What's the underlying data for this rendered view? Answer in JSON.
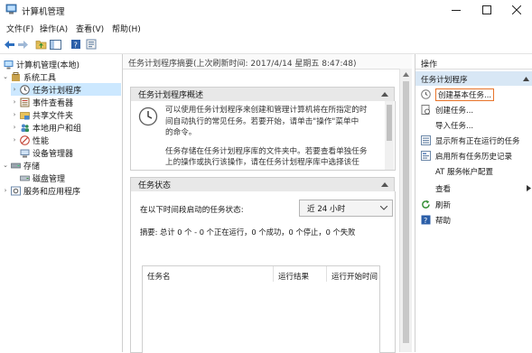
{
  "window": {
    "title": "计算机管理"
  },
  "menu": {
    "items": [
      "文件(F)",
      "操作(A)",
      "查看(V)",
      "帮助(H)"
    ]
  },
  "tree": {
    "root": "计算机管理(本地)",
    "system_tools": "系统工具",
    "task_scheduler": "任务计划程序",
    "event_viewer": "事件查看器",
    "shared_folders": "共享文件夹",
    "local_users": "本地用户和组",
    "performance": "性能",
    "device_manager": "设备管理器",
    "storage": "存储",
    "disk_management": "磁盘管理",
    "services_apps": "服务和应用程序"
  },
  "main": {
    "header": "任务计划程序摘要(上次刷新时间: 2017/4/14 星期五 8:47:48)",
    "overview": {
      "title": "任务计划程序概述",
      "para1": [
        "可以使用任务计划程序来创建和管理计算机将在所指定的时",
        "间自动执行的常见任务。若要开始，请单击\"操作\"菜单中",
        "的命令。"
      ],
      "para2": [
        "任务存储在任务计划程序库的文件夹中。若要查看单独任务",
        "上的操作或执行该操作，请在任务计划程序库中选择该任"
      ]
    },
    "status": {
      "title": "任务状态",
      "label": "在以下时间段启动的任务状态:",
      "period": "近 24 小时",
      "summary": "摘要: 总计 0 个 - 0 个正在运行，0 个成功，0 个停止，0 个失败",
      "columns": [
        "任务名",
        "运行结果",
        "运行开始时间"
      ]
    }
  },
  "actions": {
    "header": "操作",
    "section": "任务计划程序",
    "items": [
      {
        "label": "创建基本任务...",
        "icon": "wizard-icon"
      },
      {
        "label": "创建任务...",
        "icon": "task-icon"
      },
      {
        "label": "导入任务...",
        "icon": ""
      },
      {
        "label": "显示所有正在运行的任务",
        "icon": "list-icon"
      },
      {
        "label": "启用所有任务历史记录",
        "icon": "history-icon"
      },
      {
        "label": "AT 服务帐户配置",
        "icon": ""
      },
      {
        "label": "查看",
        "icon": ""
      },
      {
        "label": "刷新",
        "icon": "refresh-icon"
      },
      {
        "label": "帮助",
        "icon": "help-icon"
      }
    ]
  },
  "colors": {
    "selection": "#cce8ff",
    "highlight_border": "#e8742a",
    "section_bg": "#e8e8e8",
    "actions_header_bg": "#d8e7f5"
  }
}
